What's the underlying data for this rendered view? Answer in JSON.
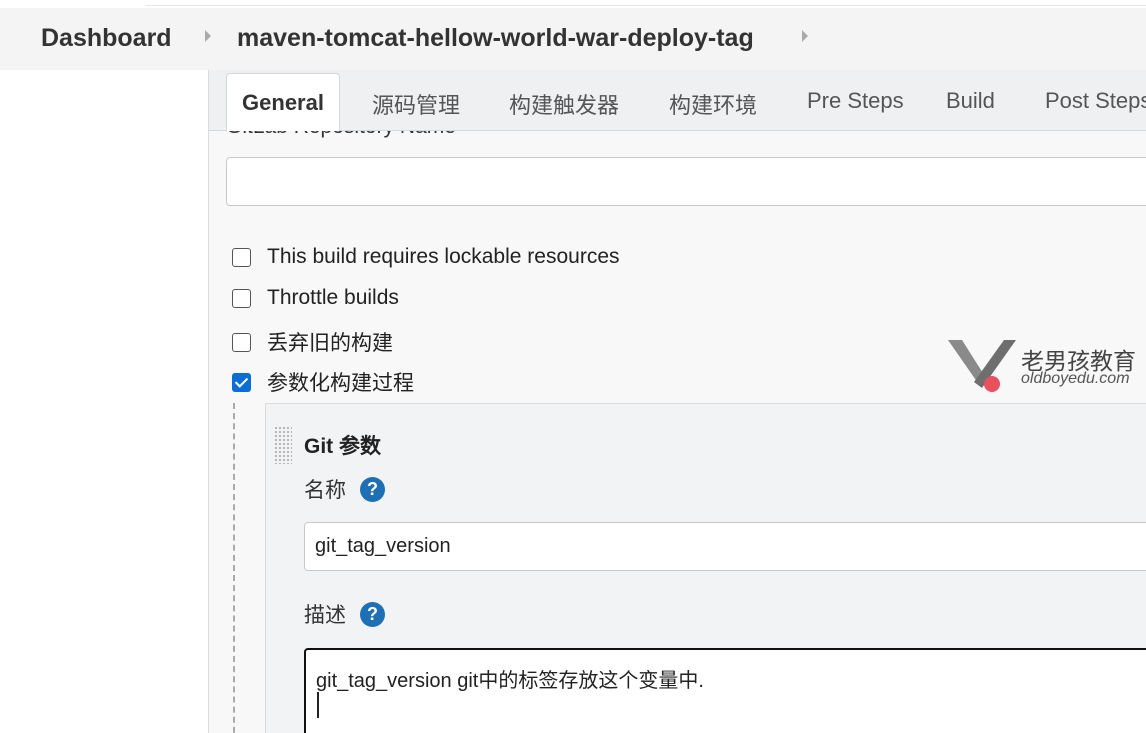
{
  "breadcrumb": {
    "items": [
      "Dashboard",
      "maven-tomcat-hellow-world-war-deploy-tag"
    ]
  },
  "tabs": [
    {
      "label": "General",
      "active": true
    },
    {
      "label": "源码管理"
    },
    {
      "label": "构建触发器"
    },
    {
      "label": "构建环境"
    },
    {
      "label": "Pre Steps"
    },
    {
      "label": "Build"
    },
    {
      "label": "Post Steps"
    }
  ],
  "form": {
    "gitlab_repo_label": "GitLab Repository Name",
    "gitlab_repo_value": "",
    "options": [
      {
        "label": "This build requires lockable resources",
        "checked": false
      },
      {
        "label": "Throttle builds",
        "checked": false
      },
      {
        "label": "丢弃旧的构建",
        "checked": false
      },
      {
        "label": "参数化构建过程",
        "checked": true
      }
    ],
    "parameter": {
      "title": "Git 参数",
      "name_label": "名称",
      "name_value": "git_tag_version",
      "desc_label": "描述",
      "desc_value": "git_tag_version git中的标签存放这个变量中."
    }
  },
  "watermark": {
    "cn": "老男孩教育",
    "en": "oldboyedu.com",
    "accent_color": "#e8505b"
  },
  "colors": {
    "help_icon": "#1f6fb5",
    "checkbox_checked": "#0b6ed4"
  }
}
